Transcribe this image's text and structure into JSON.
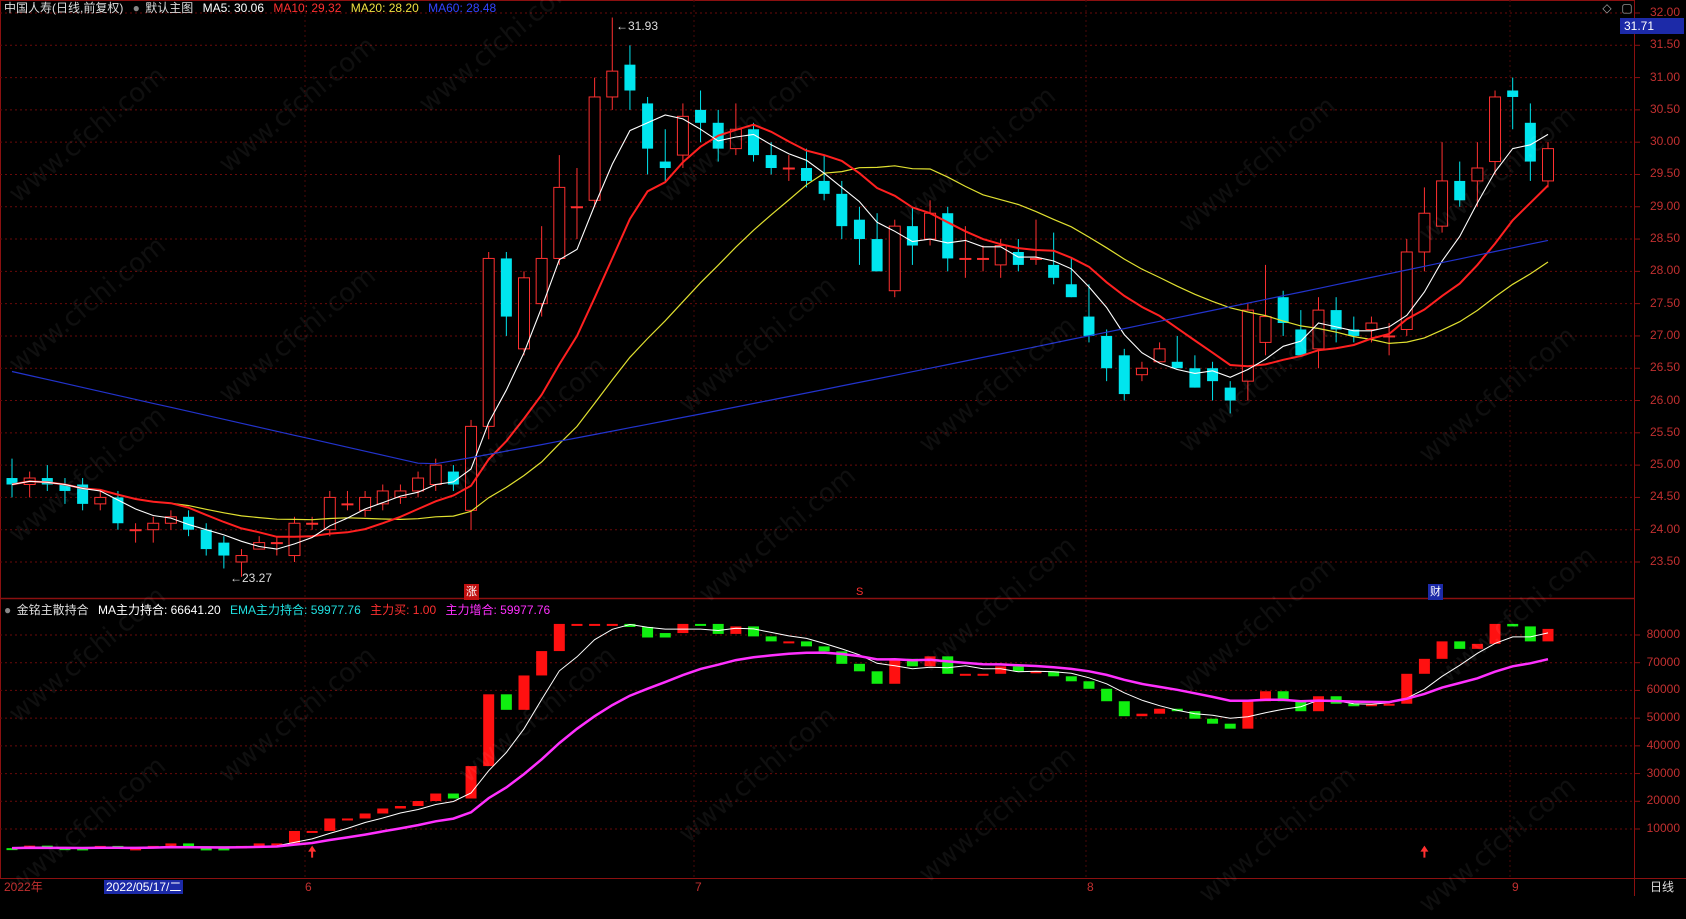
{
  "main_header": {
    "stock": "中国人寿(日线,前复权)",
    "template": "默认主图",
    "ma5": "MA5: 30.06",
    "ma10": "MA10: 29.32",
    "ma20": "MA20: 28.20",
    "ma60": "MA60: 28.48"
  },
  "sub_header": {
    "indicator": "金铭主散持合",
    "ma_main": "MA主力持合: 66641.20",
    "ema_main": "EMA主力持合: 59977.76",
    "main_buy": "主力买: 1.00",
    "main_inc": "主力增合: 59977.76"
  },
  "current_price": "31.71",
  "price_axis": [
    "32.00",
    "31.50",
    "31.00",
    "30.50",
    "30.00",
    "29.50",
    "29.00",
    "28.50",
    "28.00",
    "27.50",
    "27.00",
    "26.50",
    "26.00",
    "25.50",
    "25.00",
    "24.50",
    "24.00",
    "23.50"
  ],
  "volume_axis": [
    "80000",
    "70000",
    "60000",
    "50000",
    "40000",
    "30000",
    "20000",
    "10000"
  ],
  "date_axis": [
    {
      "label": "2022年"
    },
    {
      "label": "2022/05/17/二"
    },
    {
      "label": "6"
    },
    {
      "label": "7"
    },
    {
      "label": "8"
    },
    {
      "label": "9"
    }
  ],
  "period_label": "日线",
  "annotations": {
    "high": "31.93",
    "low": "23.27",
    "mark_zhang": "涨",
    "mark_s": "S",
    "mark_cai": "财"
  },
  "watermark": "www.cfchi.com",
  "colors": {
    "up": "#ff3030",
    "down": "#00e5ee",
    "ma5": "#ffffff",
    "ma10": "#ff2020",
    "ma20": "#e0e030",
    "ma60": "#2233cc",
    "vol_up": "#ff1010",
    "vol_down": "#10ee10",
    "ema_line": "#ff30ff"
  },
  "chart_data": {
    "type": "candlestick",
    "candles": [
      [
        24.8,
        24.7,
        25.1,
        24.5
      ],
      [
        24.7,
        24.8,
        24.9,
        24.5
      ],
      [
        24.8,
        24.7,
        25.0,
        24.6
      ],
      [
        24.7,
        24.6,
        24.8,
        24.4
      ],
      [
        24.7,
        24.4,
        24.8,
        24.3
      ],
      [
        24.4,
        24.5,
        24.6,
        24.3
      ],
      [
        24.5,
        24.1,
        24.6,
        24.0
      ],
      [
        24.0,
        24.0,
        24.1,
        23.8
      ],
      [
        24.0,
        24.1,
        24.2,
        23.8
      ],
      [
        24.1,
        24.2,
        24.3,
        24.0
      ],
      [
        24.2,
        24.0,
        24.3,
        23.9
      ],
      [
        24.0,
        23.7,
        24.1,
        23.6
      ],
      [
        23.8,
        23.6,
        23.9,
        23.4
      ],
      [
        23.5,
        23.6,
        23.7,
        23.27
      ],
      [
        23.7,
        23.8,
        23.9,
        23.7
      ],
      [
        23.8,
        23.8,
        23.9,
        23.6
      ],
      [
        23.6,
        24.1,
        24.2,
        23.5
      ],
      [
        24.1,
        24.1,
        24.2,
        24.0
      ],
      [
        24.0,
        24.5,
        24.6,
        23.9
      ],
      [
        24.4,
        24.4,
        24.6,
        24.3
      ],
      [
        24.3,
        24.5,
        24.6,
        24.2
      ],
      [
        24.4,
        24.6,
        24.7,
        24.3
      ],
      [
        24.5,
        24.6,
        24.7,
        24.4
      ],
      [
        24.6,
        24.8,
        24.9,
        24.5
      ],
      [
        24.7,
        25.0,
        25.1,
        24.6
      ],
      [
        24.9,
        24.7,
        25.0,
        24.6
      ],
      [
        24.3,
        25.6,
        25.7,
        24.0
      ],
      [
        25.6,
        28.2,
        28.3,
        25.4
      ],
      [
        28.2,
        27.3,
        28.3,
        27.0
      ],
      [
        26.8,
        27.9,
        28.0,
        26.7
      ],
      [
        27.5,
        28.2,
        28.7,
        27.3
      ],
      [
        28.2,
        29.3,
        29.8,
        28.1
      ],
      [
        29.0,
        29.0,
        29.6,
        28.5
      ],
      [
        29.1,
        30.7,
        31.0,
        29.0
      ],
      [
        30.7,
        31.1,
        31.93,
        30.5
      ],
      [
        31.2,
        30.8,
        31.5,
        30.5
      ],
      [
        30.6,
        29.9,
        30.7,
        29.5
      ],
      [
        29.7,
        29.6,
        30.2,
        29.4
      ],
      [
        29.8,
        30.4,
        30.6,
        29.6
      ],
      [
        30.5,
        30.3,
        30.8,
        30.0
      ],
      [
        30.3,
        29.9,
        30.5,
        29.7
      ],
      [
        29.9,
        30.2,
        30.6,
        29.8
      ],
      [
        30.2,
        29.8,
        30.3,
        29.7
      ],
      [
        29.8,
        29.6,
        30.0,
        29.5
      ],
      [
        29.6,
        29.6,
        29.8,
        29.4
      ],
      [
        29.6,
        29.4,
        29.9,
        29.3
      ],
      [
        29.4,
        29.2,
        29.8,
        29.1
      ],
      [
        29.2,
        28.7,
        29.4,
        28.5
      ],
      [
        28.8,
        28.5,
        29.0,
        28.1
      ],
      [
        28.5,
        28.0,
        28.9,
        28.0
      ],
      [
        27.7,
        28.7,
        28.8,
        27.6
      ],
      [
        28.7,
        28.4,
        29.0,
        28.1
      ],
      [
        28.5,
        28.9,
        29.1,
        28.4
      ],
      [
        28.9,
        28.2,
        29.0,
        28.0
      ],
      [
        28.2,
        28.2,
        28.7,
        27.9
      ],
      [
        28.2,
        28.2,
        28.4,
        28.0
      ],
      [
        28.1,
        28.4,
        28.5,
        27.9
      ],
      [
        28.3,
        28.1,
        28.5,
        28.0
      ],
      [
        28.2,
        28.2,
        28.8,
        28.1
      ],
      [
        28.1,
        27.9,
        28.6,
        27.8
      ],
      [
        27.8,
        27.6,
        28.2,
        27.6
      ],
      [
        27.3,
        27.0,
        27.8,
        26.9
      ],
      [
        27.0,
        26.5,
        27.1,
        26.3
      ],
      [
        26.7,
        26.1,
        26.8,
        26.0
      ],
      [
        26.4,
        26.5,
        26.6,
        26.3
      ],
      [
        26.6,
        26.8,
        26.9,
        26.6
      ],
      [
        26.6,
        26.5,
        27.0,
        26.5
      ],
      [
        26.5,
        26.2,
        26.7,
        26.2
      ],
      [
        26.5,
        26.3,
        26.6,
        26.0
      ],
      [
        26.2,
        26.0,
        26.3,
        25.8
      ],
      [
        26.3,
        27.4,
        27.5,
        26.0
      ],
      [
        26.9,
        27.3,
        28.1,
        26.7
      ],
      [
        27.6,
        27.2,
        27.7,
        27.0
      ],
      [
        27.1,
        26.7,
        27.4,
        26.7
      ],
      [
        26.8,
        27.4,
        27.6,
        26.5
      ],
      [
        27.4,
        27.1,
        27.6,
        26.9
      ],
      [
        27.1,
        27.0,
        27.3,
        26.9
      ],
      [
        27.1,
        27.2,
        27.3,
        26.9
      ],
      [
        27.0,
        27.0,
        27.2,
        26.7
      ],
      [
        27.1,
        28.3,
        28.5,
        27.0
      ],
      [
        28.3,
        28.9,
        29.3,
        28.0
      ],
      [
        28.7,
        29.4,
        30.0,
        28.6
      ],
      [
        29.4,
        29.1,
        29.7,
        29.0
      ],
      [
        29.4,
        29.6,
        30.0,
        29.0
      ],
      [
        29.7,
        30.7,
        30.8,
        29.5
      ],
      [
        30.8,
        30.7,
        31.0,
        30.2
      ],
      [
        30.3,
        29.7,
        30.6,
        29.4
      ],
      [
        29.4,
        29.9,
        30.0,
        29.3
      ]
    ],
    "ma5_end": 30.06,
    "ma10_end": 29.32,
    "ma20_end": 28.2,
    "ma60_end": 28.48,
    "high": 31.93,
    "low": 23.27,
    "ylim": [
      23.2,
      32.0
    ]
  }
}
